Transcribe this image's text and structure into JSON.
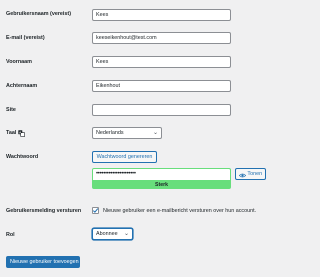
{
  "form": {
    "username": {
      "label": "Gebruikersnaam (vereist)",
      "value": "Kees"
    },
    "email": {
      "label": "E-mail (vereist)",
      "value": "keeseikenhout@test.com"
    },
    "first_name": {
      "label": "Voornaam",
      "value": "Kees"
    },
    "last_name": {
      "label": "Achternaam",
      "value": "Eikenhout"
    },
    "site": {
      "label": "Site",
      "value": ""
    },
    "language": {
      "label": "Taal",
      "icon": "translation-icon",
      "selected": "Nederlands"
    },
    "password": {
      "label": "Wachtwoord",
      "generate_label": "Wachtwoord genereren",
      "masked_value": "••••••••••••••••••••••",
      "show_label": "Tonen",
      "show_icon": "eye-icon",
      "strength_label": "Sterk",
      "strength_color": "#68de7c"
    },
    "notification": {
      "label": "Gebruikersmelding versturen",
      "checked": true,
      "description": "Nieuwe gebruiker een e-mailbericht versturen over hun account."
    },
    "role": {
      "label": "Rol",
      "selected": "Abonnee"
    },
    "submit_label": "Nieuwe gebruiker toevoegen"
  },
  "colors": {
    "accent": "#2271b1",
    "background": "#f0f0f1",
    "strong": "#68de7c"
  }
}
